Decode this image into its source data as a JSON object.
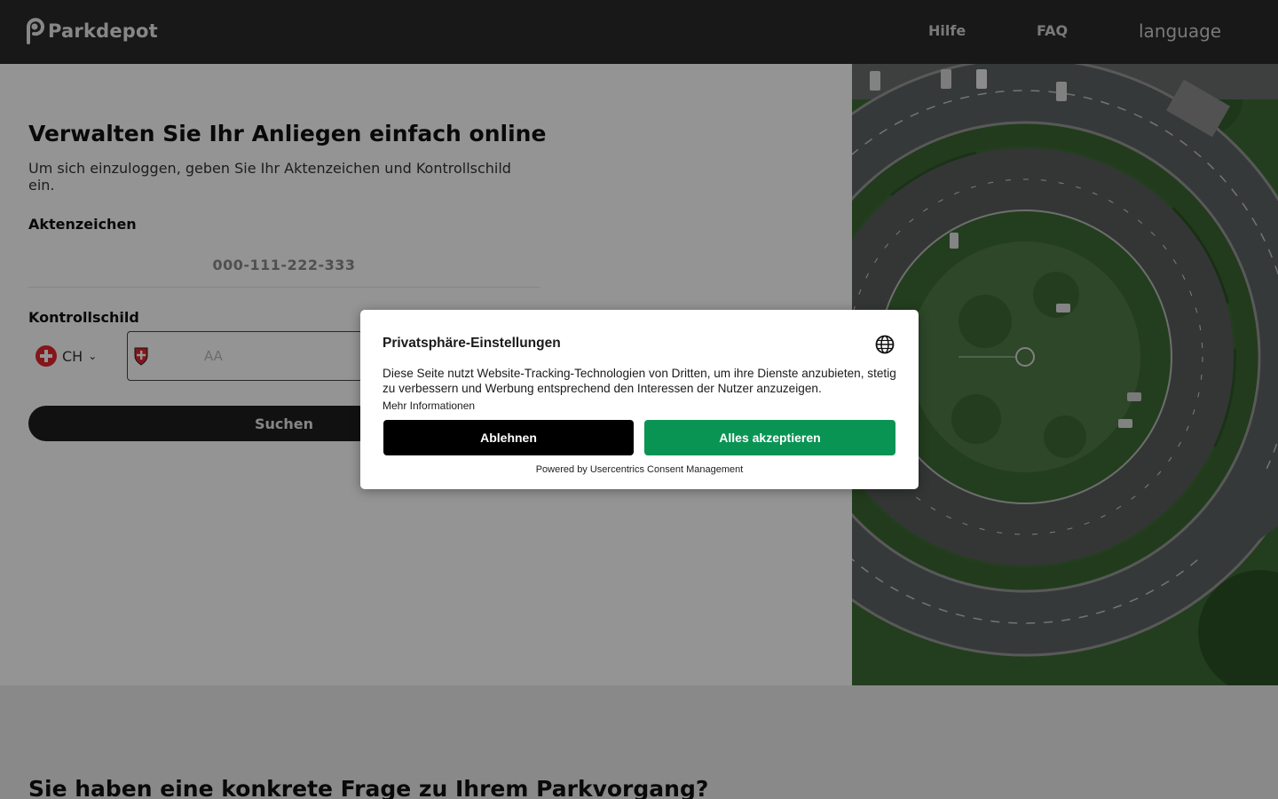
{
  "header": {
    "logo_text": "Parkdepot",
    "nav": {
      "hilfe": "Hilfe",
      "faq": "FAQ",
      "language": "language"
    }
  },
  "hero": {
    "headline": "Verwalten Sie Ihr Anliegen einfach online",
    "subline": "Um sich einzuloggen, geben Sie Ihr Aktenzeichen und Kontrollschild ein.",
    "aktenzeichen_label": "Aktenzeichen",
    "aktenzeichen_placeholder": "000-111-222-333",
    "kontrollschild_label": "Kontrollschild",
    "country_code": "CH",
    "plate_placeholder": "AA",
    "search_button": "Suchen",
    "photo_icon": "aerial-parking-lot-image"
  },
  "section2": {
    "title": "Sie haben eine konkrete Frage zu Ihrem Parkvorgang?"
  },
  "consent": {
    "title": "Privatsphäre-Einstellungen",
    "text": "Diese Seite nutzt Website-Tracking-Technologien von Dritten, um ihre Dienste anzubieten, stetig zu verbessern und Werbung entsprechend den Interessen der Nutzer anzuzeigen.",
    "more_info": "Mehr Informationen",
    "decline": "Ablehnen",
    "accept": "Alles akzeptieren",
    "powered_by": "Powered by Usercentrics Consent Management",
    "accent_color": "#0a9454"
  }
}
